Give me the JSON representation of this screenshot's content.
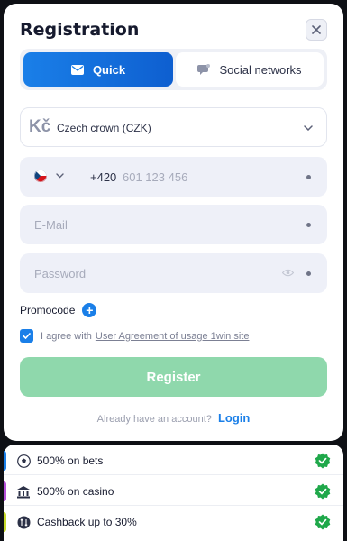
{
  "modal": {
    "title": "Registration",
    "tabs": [
      {
        "label": "Quick",
        "icon": "envelope-icon"
      },
      {
        "label": "Social networks",
        "icon": "chat-bubble-icon"
      }
    ],
    "currency": {
      "symbol": "Kč",
      "label": "Czech crown (CZK)"
    },
    "phone": {
      "code": "+420",
      "placeholder": "601 123 456",
      "flag": "czech-flag-icon"
    },
    "email": {
      "placeholder": "E-Mail"
    },
    "password": {
      "placeholder": "Password"
    },
    "promocode_label": "Promocode",
    "agree": {
      "prefix": "I agree with",
      "link": "User Agreement of usage 1win site"
    },
    "register_label": "Register",
    "already": {
      "text": "Already have an account?",
      "login": "Login"
    }
  },
  "bonuses": [
    {
      "label": "500% on bets",
      "icon": "soccer-ball-icon",
      "accent": "#1a7fe8"
    },
    {
      "label": "500% on casino",
      "icon": "casino-icon",
      "accent": "#b44fd8"
    },
    {
      "label": "Cashback up to 30%",
      "icon": "cashback-icon",
      "accent": "#c5d82a"
    }
  ],
  "colors": {
    "primary": "#1a7fe8",
    "register_disabled": "#8fd8ac",
    "check_green": "#1fa84a"
  }
}
